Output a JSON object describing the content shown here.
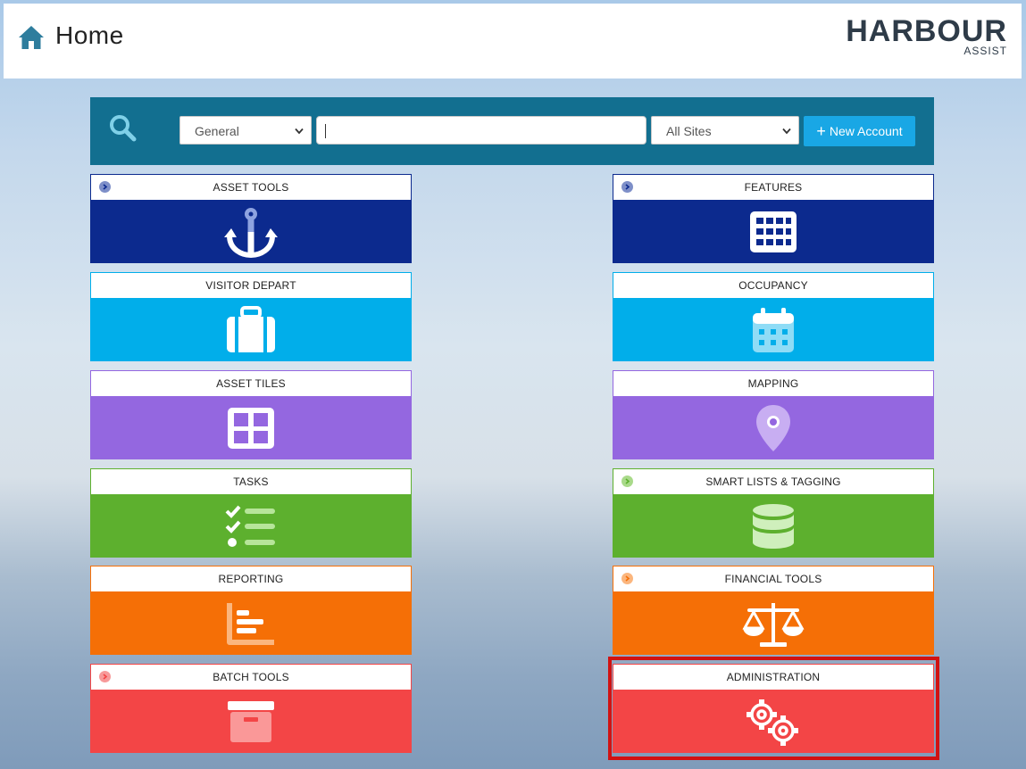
{
  "header": {
    "title": "Home",
    "logo_main": "HARBOUR",
    "logo_sub": "ASSIST"
  },
  "search": {
    "category_selected": "General",
    "query_value": "",
    "site_selected": "All Sites",
    "new_account_label": "New Account"
  },
  "tiles": [
    {
      "label": "ASSET TOOLS",
      "color": "#0c2a8e",
      "icon": "anchor-icon",
      "badge": true
    },
    {
      "label": "FEATURES",
      "color": "#0c2a8e",
      "icon": "grid-icon",
      "badge": true
    },
    {
      "label": "VISITOR DEPART",
      "color": "#01aeea",
      "icon": "suitcase-icon",
      "badge": false
    },
    {
      "label": "OCCUPANCY",
      "color": "#01aeea",
      "icon": "calendar-icon",
      "badge": false
    },
    {
      "label": "ASSET TILES",
      "color": "#9467e0",
      "icon": "tiles-icon",
      "badge": false
    },
    {
      "label": "MAPPING",
      "color": "#9467e0",
      "icon": "map-pin-icon",
      "badge": false
    },
    {
      "label": "TASKS",
      "color": "#5db02e",
      "icon": "task-list-icon",
      "badge": false
    },
    {
      "label": "SMART LISTS & TAGGING",
      "color": "#5db02e",
      "icon": "database-icon",
      "badge": true
    },
    {
      "label": "REPORTING",
      "color": "#f56f06",
      "icon": "bar-report-icon",
      "badge": false
    },
    {
      "label": "FINANCIAL TOOLS",
      "color": "#f56f06",
      "icon": "scales-icon",
      "badge": true
    },
    {
      "label": "BATCH TOOLS",
      "color": "#f34546",
      "icon": "archive-box-icon",
      "badge": true
    },
    {
      "label": "ADMINISTRATION",
      "color": "#f34546",
      "icon": "gears-icon",
      "badge": false
    }
  ],
  "highlight_color": "#d11212"
}
